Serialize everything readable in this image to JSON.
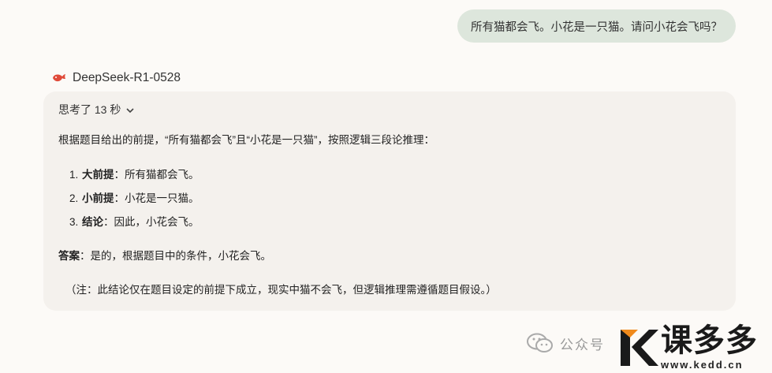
{
  "conversation": {
    "user_message": "所有猫都会飞。小花是一只猫。请问小花会飞吗？",
    "model": {
      "name": "DeepSeek-R1-0528",
      "icon": "whale-icon",
      "accent_color": "#e04b3a"
    },
    "thinking": {
      "label": "思考了 13 秒"
    },
    "answer": {
      "intro": "根据题目给出的前提，“所有猫都会飞”且“小花是一只猫”，按照逻辑三段论推理：",
      "steps": [
        {
          "num": "1.",
          "term": "大前提",
          "text": "：所有猫都会飞。"
        },
        {
          "num": "2.",
          "term": "小前提",
          "text": "：小花是一只猫。"
        },
        {
          "num": "3.",
          "term": "结论",
          "text": "：因此，小花会飞。"
        }
      ],
      "conclusion_term": "答案",
      "conclusion_text": "：是的，根据题目中的条件，小花会飞。",
      "note": "（注：此结论仅在题目设定的前提下成立，现实中猫不会飞，但逻辑推理需遵循题目假设。）"
    }
  },
  "watermark": {
    "wechat_text": "公众号",
    "brand_name": "课多多",
    "brand_url": "www.kedd.cn",
    "brand_color": "#f08a1c"
  },
  "colors": {
    "background": "#fcfaf7",
    "user_bubble": "#dde6dc",
    "answer_card": "#f4f1ed"
  }
}
